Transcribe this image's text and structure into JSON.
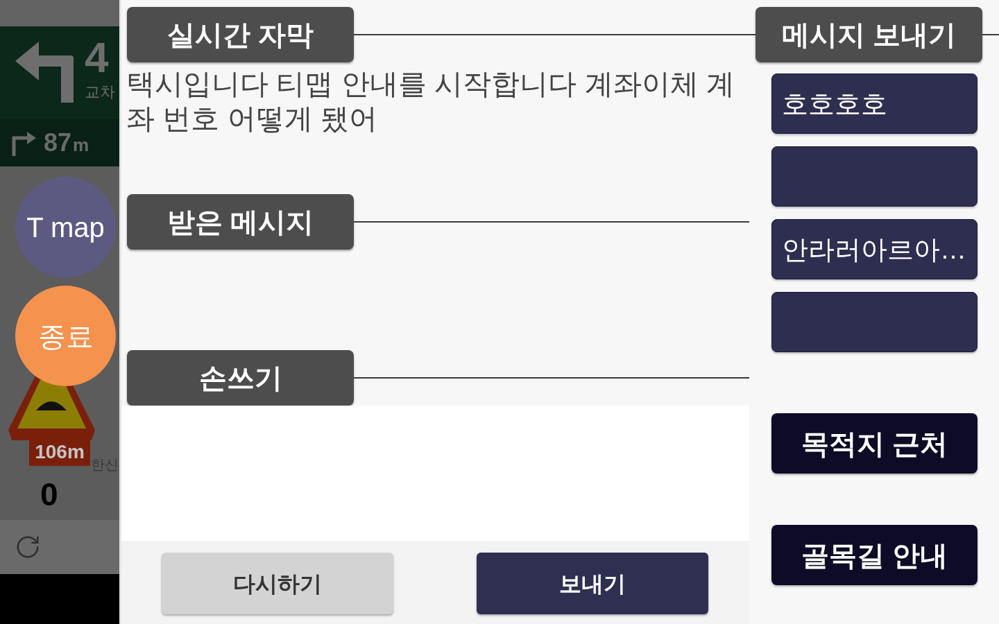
{
  "map": {
    "guidance": {
      "distance": "4",
      "place": "교차"
    },
    "next_guidance": {
      "distance": "87",
      "unit": "m"
    },
    "buttons": [
      {
        "label": "T map",
        "color": "#5d5a82"
      },
      {
        "label": "종료",
        "color": "#f4924e"
      }
    ],
    "warning_sign": {
      "distance": "106m"
    },
    "place_label": "한신",
    "speed": "0"
  },
  "subtitles": {
    "title": "실시간 자막",
    "text": "택시입니다 티맵 안내를 시작합니다 계좌이체 계좌 번호 어떻게 됐어"
  },
  "received_messages": {
    "title": "받은 메시지"
  },
  "handwriting": {
    "title": "손쓰기"
  },
  "actions": [
    {
      "label": "다시하기",
      "kind": "secondary"
    },
    {
      "label": "보내기",
      "kind": "primary"
    }
  ],
  "send_messages": {
    "title": "메시지 보내기",
    "presets": [
      {
        "kind": "text",
        "text": "호호호호"
      },
      {
        "kind": "blank"
      },
      {
        "kind": "text",
        "text": "안라러아르아…"
      },
      {
        "kind": "blank"
      }
    ]
  },
  "shortcuts": [
    {
      "label": "목적지 근처"
    },
    {
      "label": "골목길 안내"
    }
  ]
}
